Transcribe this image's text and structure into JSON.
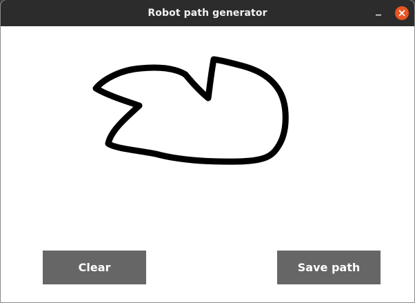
{
  "window": {
    "title": "Robot path generator"
  },
  "titlebar": {
    "minimize_icon": "minimize-icon",
    "close_icon": "close-icon",
    "close_color": "#e95420"
  },
  "buttons": {
    "clear_label": "Clear",
    "save_label": "Save path",
    "color": "#666666"
  },
  "drawing": {
    "stroke_color": "#000000",
    "description_icon": "freehand-path"
  }
}
